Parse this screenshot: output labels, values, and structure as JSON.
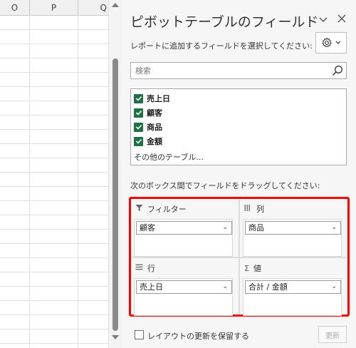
{
  "spreadsheet": {
    "columns": [
      "O",
      "P",
      "Q"
    ]
  },
  "pane": {
    "title": "ピボットテーブルのフィールド",
    "close_icon": "close-icon",
    "menu_icon": "chevron-down-icon",
    "subtitle": "レポートに追加するフィールドを選択してください:",
    "settings_icon": "gear-icon"
  },
  "search": {
    "placeholder": "検索",
    "icon": "search-icon"
  },
  "fields": {
    "items": [
      {
        "label": "売上日",
        "checked": true
      },
      {
        "label": "顧客",
        "checked": true
      },
      {
        "label": "商品",
        "checked": true
      },
      {
        "label": "金額",
        "checked": true
      }
    ],
    "more_tables": "その他のテーブル..."
  },
  "drag_hint": "次のボックス間でフィールドをドラッグしてください:",
  "areas": {
    "filters": {
      "label": "フィルター",
      "icon": "filter-icon",
      "value": "顧客"
    },
    "columns": {
      "label": "列",
      "icon": "columns-icon",
      "value": "商品"
    },
    "rows": {
      "label": "行",
      "icon": "rows-icon",
      "value": "売上日"
    },
    "values": {
      "label": "値",
      "icon": "sigma-icon",
      "value": "合計 / 金額"
    }
  },
  "footer": {
    "defer_label": "レイアウトの更新を保留する",
    "defer_checked": false,
    "update_label": "更新"
  },
  "colors": {
    "accent_green": "#1e7145",
    "highlight_red": "#ff0000"
  }
}
